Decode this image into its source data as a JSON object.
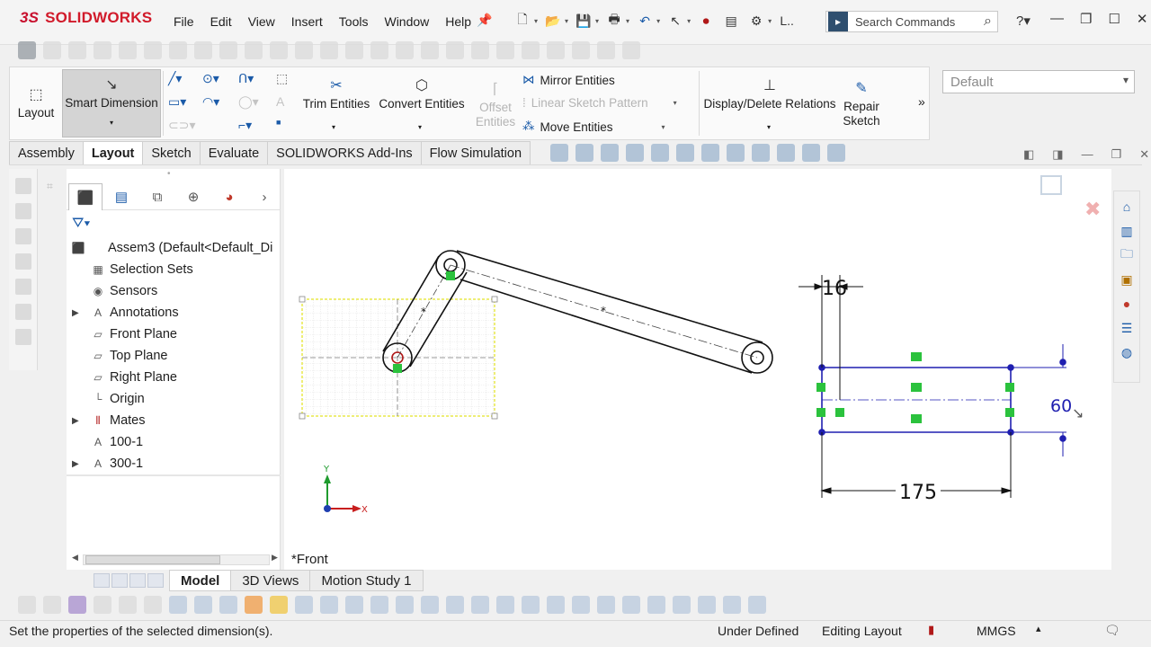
{
  "app": {
    "logo_ds": "3S",
    "logo_name": "SOLIDWORKS"
  },
  "menu": [
    "File",
    "Edit",
    "View",
    "Insert",
    "Tools",
    "Window",
    "Help"
  ],
  "search": {
    "placeholder": "Search Commands"
  },
  "ribbon": {
    "layout": "Layout",
    "smart_dimension": "Smart Dimension",
    "trim_entities": "Trim Entities",
    "convert_entities": "Convert Entities",
    "offset_entities": "Offset Entities",
    "mirror_entities": "Mirror Entities",
    "linear_sketch_pattern": "Linear Sketch Pattern",
    "move_entities": "Move Entities",
    "display_delete_relations": "Display/Delete Relations",
    "repair_sketch": "Repair Sketch",
    "configuration_dropdown": "Default",
    "more": "»"
  },
  "command_tabs": [
    "Assembly",
    "Layout",
    "Sketch",
    "Evaluate",
    "SOLIDWORKS Add-Ins",
    "Flow Simulation"
  ],
  "active_tab": "Layout",
  "feature_tree": {
    "root": "Assem3  (Default<Default_Di",
    "items": [
      {
        "label": "Selection Sets",
        "expandable": false,
        "icon": "selection-sets-icon"
      },
      {
        "label": "Sensors",
        "expandable": false,
        "icon": "sensors-icon"
      },
      {
        "label": "Annotations",
        "expandable": true,
        "icon": "annotations-icon"
      },
      {
        "label": "Front Plane",
        "expandable": false,
        "icon": "plane-icon"
      },
      {
        "label": "Top Plane",
        "expandable": false,
        "icon": "plane-icon"
      },
      {
        "label": "Right Plane",
        "expandable": false,
        "icon": "plane-icon"
      },
      {
        "label": "Origin",
        "expandable": false,
        "icon": "origin-icon"
      },
      {
        "label": "Mates",
        "expandable": true,
        "icon": "mates-icon"
      },
      {
        "label": "100-1",
        "expandable": false,
        "icon": "block-icon"
      },
      {
        "label": "300-1",
        "expandable": true,
        "icon": "block-icon"
      }
    ]
  },
  "canvas": {
    "view_name": "*Front",
    "dim_width": "175",
    "dim_small": "16",
    "dim_editing": "60",
    "axis_x": "X",
    "axis_y": "Y"
  },
  "bottom_tabs": [
    "Model",
    "3D Views",
    "Motion Study 1"
  ],
  "active_bottom_tab": "Model",
  "status": {
    "message": "Set the properties of the selected dimension(s).",
    "definition": "Under Defined",
    "mode": "Editing Layout",
    "units": "MMGS",
    "units_caret": "▴"
  },
  "colors": {
    "sketch_blue": "#1f1fb0",
    "relation_green": "#2bc23d",
    "block_yellow": "#f2f27a",
    "brand_red": "#c8102e"
  }
}
